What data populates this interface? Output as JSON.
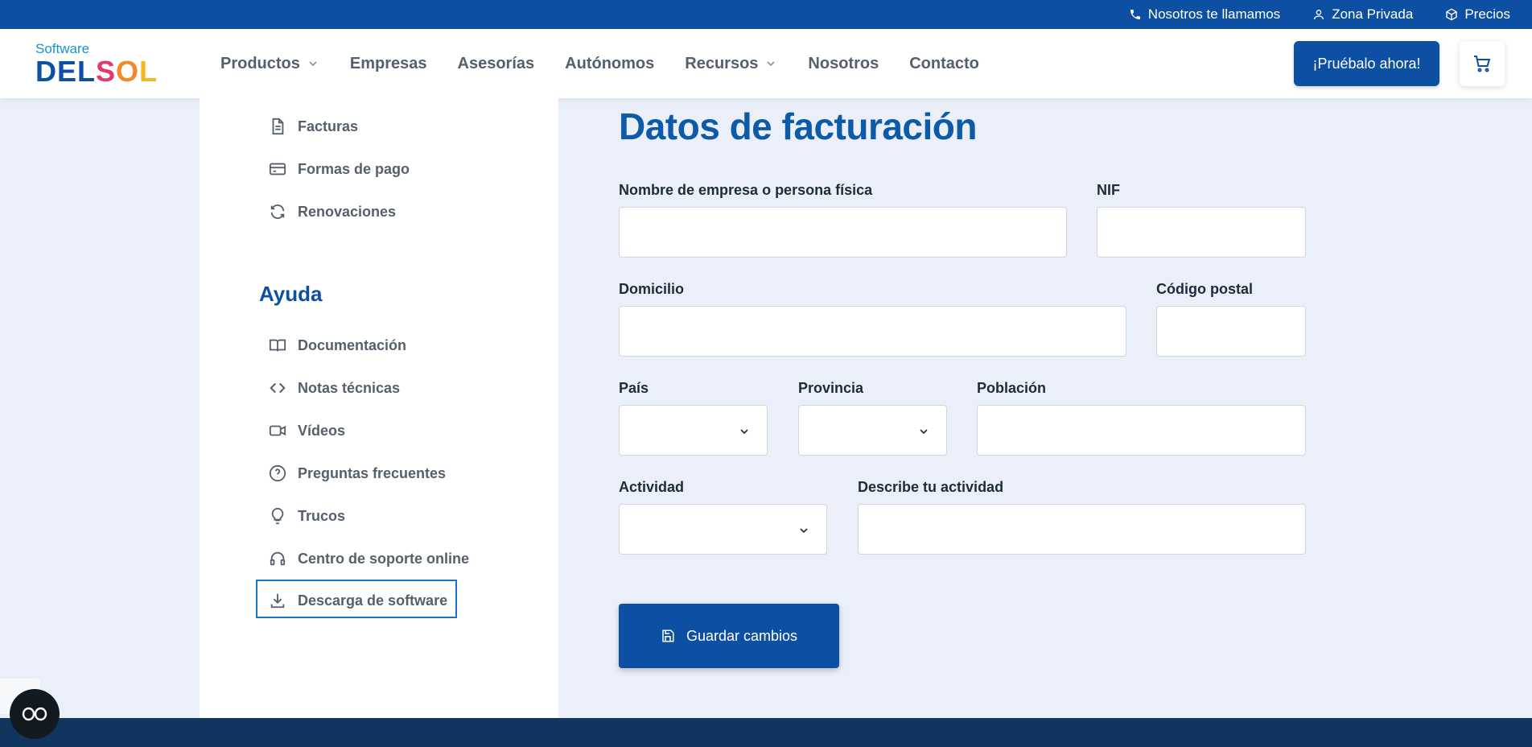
{
  "topbar": {
    "call_label": "Nosotros te llamamos",
    "private_label": "Zona Privada",
    "prices_label": "Precios"
  },
  "brand": {
    "logo_small": "Software",
    "logo_main": "DELSOL",
    "colors": {
      "primary": "#0d4fa3",
      "title": "#0d5aa8",
      "footer": "#10355e"
    }
  },
  "nav": {
    "items": [
      {
        "label": "Productos",
        "dropdown": true
      },
      {
        "label": "Empresas"
      },
      {
        "label": "Asesorías"
      },
      {
        "label": "Autónomos"
      },
      {
        "label": "Recursos",
        "dropdown": true
      },
      {
        "label": "Nosotros"
      },
      {
        "label": "Contacto"
      }
    ],
    "cta_label": "¡Pruébalo ahora!",
    "cart_icon": "cart-icon"
  },
  "sidebar": {
    "account_items": [
      {
        "label": "Facturas",
        "icon": "document-icon"
      },
      {
        "label": "Formas de pago",
        "icon": "credit-card-icon"
      },
      {
        "label": "Renovaciones",
        "icon": "refresh-icon"
      }
    ],
    "help_title": "Ayuda",
    "help_items": [
      {
        "label": "Documentación",
        "icon": "book-icon"
      },
      {
        "label": "Notas técnicas",
        "icon": "code-icon"
      },
      {
        "label": "Vídeos",
        "icon": "video-icon"
      },
      {
        "label": "Preguntas frecuentes",
        "icon": "question-icon"
      },
      {
        "label": "Trucos",
        "icon": "lightbulb-icon"
      },
      {
        "label": "Centro de soporte online",
        "icon": "headset-icon"
      },
      {
        "label": "Descarga de software",
        "icon": "download-icon"
      }
    ]
  },
  "form": {
    "title": "Datos de facturación",
    "fields": {
      "name": {
        "label": "Nombre de empresa o persona física",
        "value": ""
      },
      "nif": {
        "label": "NIF",
        "value": ""
      },
      "address": {
        "label": "Domicilio",
        "value": ""
      },
      "postal": {
        "label": "Código postal",
        "value": ""
      },
      "country": {
        "label": "País",
        "value": ""
      },
      "province": {
        "label": "Provincia",
        "value": ""
      },
      "city": {
        "label": "Población",
        "value": ""
      },
      "activity": {
        "label": "Actividad",
        "value": ""
      },
      "activity_desc": {
        "label": "Describe tu actividad",
        "value": ""
      }
    },
    "save_label": "Guardar cambios"
  }
}
